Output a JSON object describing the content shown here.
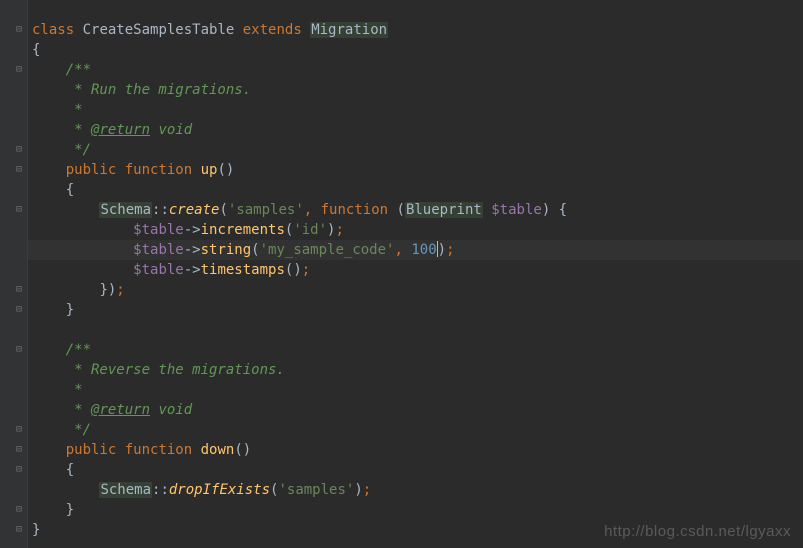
{
  "code": {
    "class_kw": "class",
    "class_name": "CreateSamplesTable",
    "extends_kw": "extends",
    "parent_class": "Migration",
    "doc_up_1": "/**",
    "doc_up_2": " * Run the migrations.",
    "doc_up_3": " *",
    "doc_up_4_tag": "@return",
    "doc_up_4_rest": " void",
    "doc_up_5": " */",
    "public_kw": "public",
    "function_kw": "function",
    "up_method": "up",
    "schema_class": "Schema",
    "create_method": "create",
    "samples_str": "'samples'",
    "blueprint_type": "Blueprint",
    "table_var": "$table",
    "increments_method": "increments",
    "id_str": "'id'",
    "string_method": "string",
    "sample_code_str": "'my_sample_code'",
    "hundred": "100",
    "timestamps_method": "timestamps",
    "doc_down_1": "/**",
    "doc_down_2": " * Reverse the migrations.",
    "doc_down_3": " *",
    "doc_down_4_tag": "@return",
    "doc_down_4_rest": " void",
    "doc_down_5": " */",
    "down_method": "down",
    "dropifexists_method": "dropIfExists"
  },
  "watermark": "http://blog.csdn.net/lgyaxx"
}
